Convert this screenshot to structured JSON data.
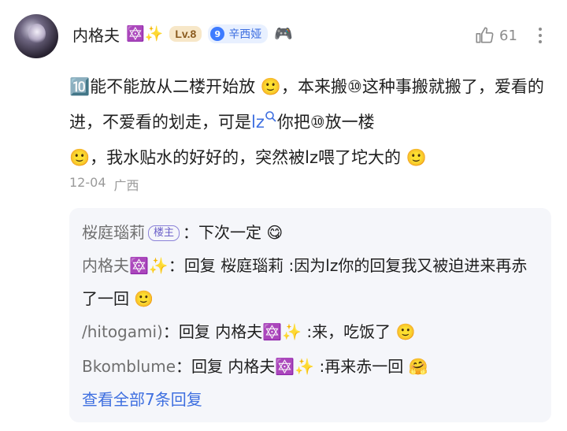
{
  "user": {
    "name": "内格夫",
    "name_emojis": "🔯✨",
    "level": "Lv.8",
    "fan_badge_num": "9",
    "fan_badge_name": "辛西娅",
    "extra_emoji": "🎮"
  },
  "like_count": "61",
  "comment": {
    "prefix_emoji": "🔟",
    "text1": "能不能放从二楼开始放",
    "emoji1": "🙂",
    "text2": "，本来搬⑩这种事搬就搬了，爱看的进，不爱看的划走，可是",
    "lz": "lz",
    "text3": "你把⑩放一楼",
    "emoji2": "🙂",
    "text4": "，我水贴水的好好的，突然被lz喂了坨大的",
    "emoji3": "🙂"
  },
  "meta": {
    "date": "12-04",
    "location": "广西"
  },
  "replies": [
    {
      "name": "桜庭瑙莉",
      "tag": "楼主",
      "sep": "：",
      "text": "下次一定",
      "emoji": "😋"
    },
    {
      "name": "内格夫🔯✨",
      "sep": "：",
      "text": "回复 桜庭瑙莉 :因为lz你的回复我又被迫进来再赤了一回",
      "emoji": "🙂"
    },
    {
      "name": "/hitogami)",
      "sep": "：",
      "text": "回复 内格夫🔯✨ :来，吃饭了",
      "emoji": "🙂"
    },
    {
      "name": "Bkomblume",
      "sep": "：",
      "text": "回复 内格夫🔯✨ :再来赤一回",
      "emoji": "🤗"
    }
  ],
  "view_all": "查看全部7条回复",
  "colors": {
    "link": "#3e6fe0",
    "level_bg": "#f7e7c8",
    "panel_bg": "#f5f6fa"
  }
}
